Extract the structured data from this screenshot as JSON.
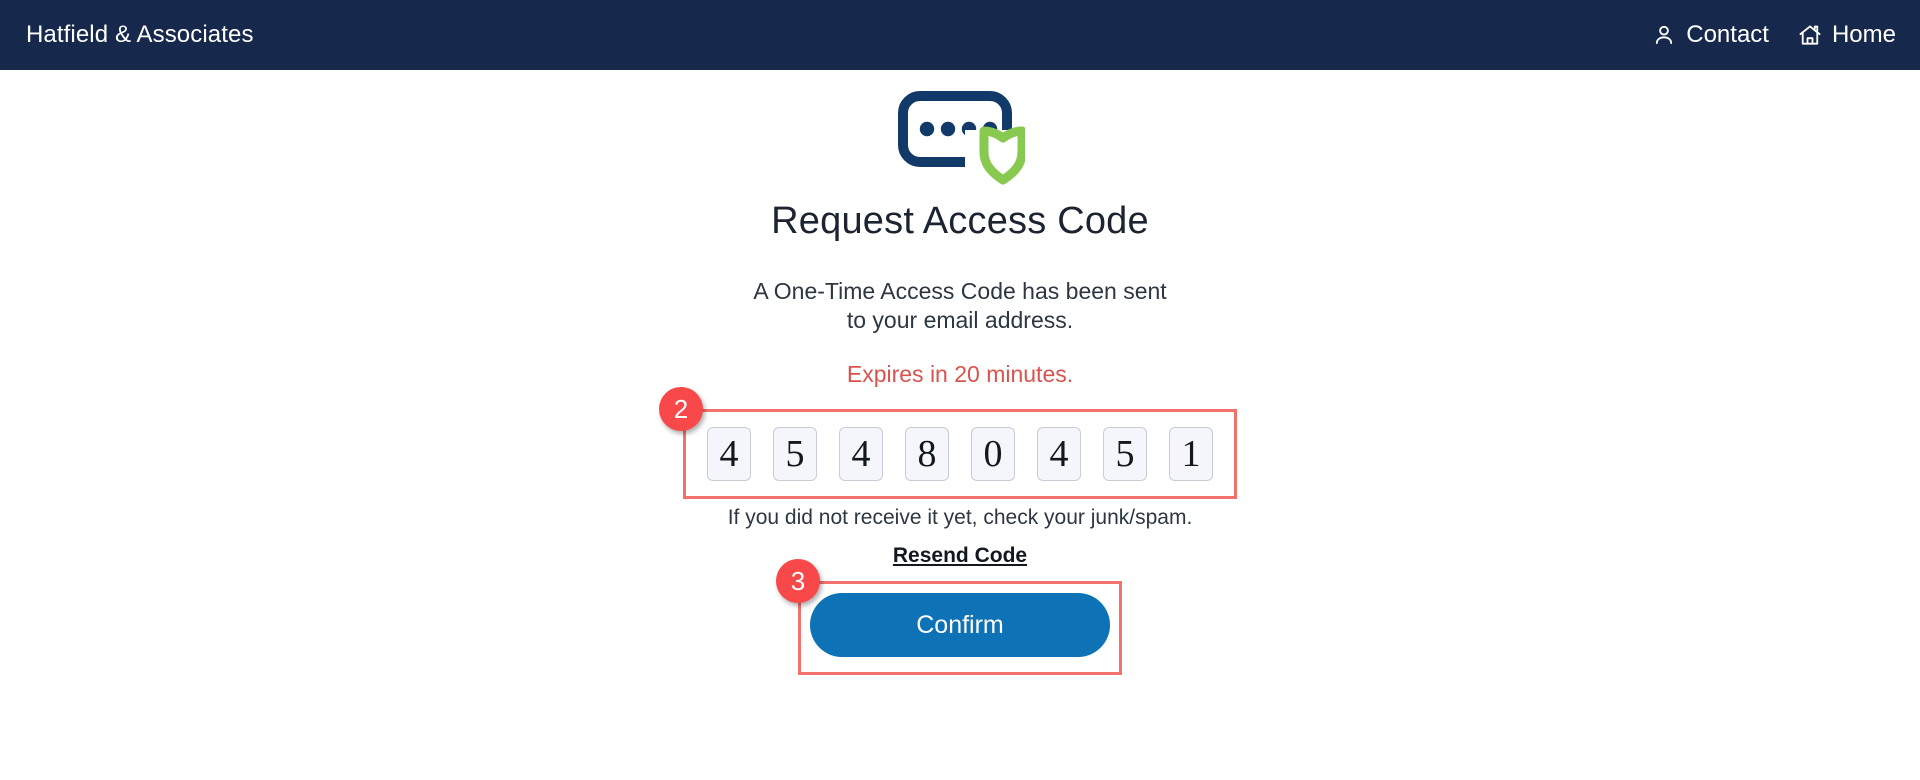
{
  "header": {
    "brand": "Hatfield & Associates",
    "nav": [
      {
        "label": "Contact",
        "icon": "user-icon"
      },
      {
        "label": "Home",
        "icon": "home-icon"
      }
    ]
  },
  "logo": {
    "icon": "password-shield-icon",
    "field_color": "#113A69",
    "shield_color": "#88C94F"
  },
  "main": {
    "title": "Request Access Code",
    "lede_line1": "A One-Time Access Code has been sent",
    "lede_line2": "to your email address.",
    "expiry": "Expires in 20 minutes.",
    "expiry_color": "#D9534F",
    "otp": {
      "digits": [
        "4",
        "5",
        "4",
        "8",
        "0",
        "4",
        "5",
        "1"
      ],
      "code": "45480451",
      "length": 8
    },
    "hint": "If you did not receive it yet, check your junk/spam.",
    "resend_label": "Resend Code",
    "confirm_label": "Confirm",
    "confirm_color": "#0E72B6"
  },
  "annotations": {
    "badge_color": "#F8484A",
    "box_color": "#F4726E",
    "items": [
      {
        "number": "2",
        "target": "otp-input-group"
      },
      {
        "number": "3",
        "target": "confirm-button"
      }
    ]
  }
}
